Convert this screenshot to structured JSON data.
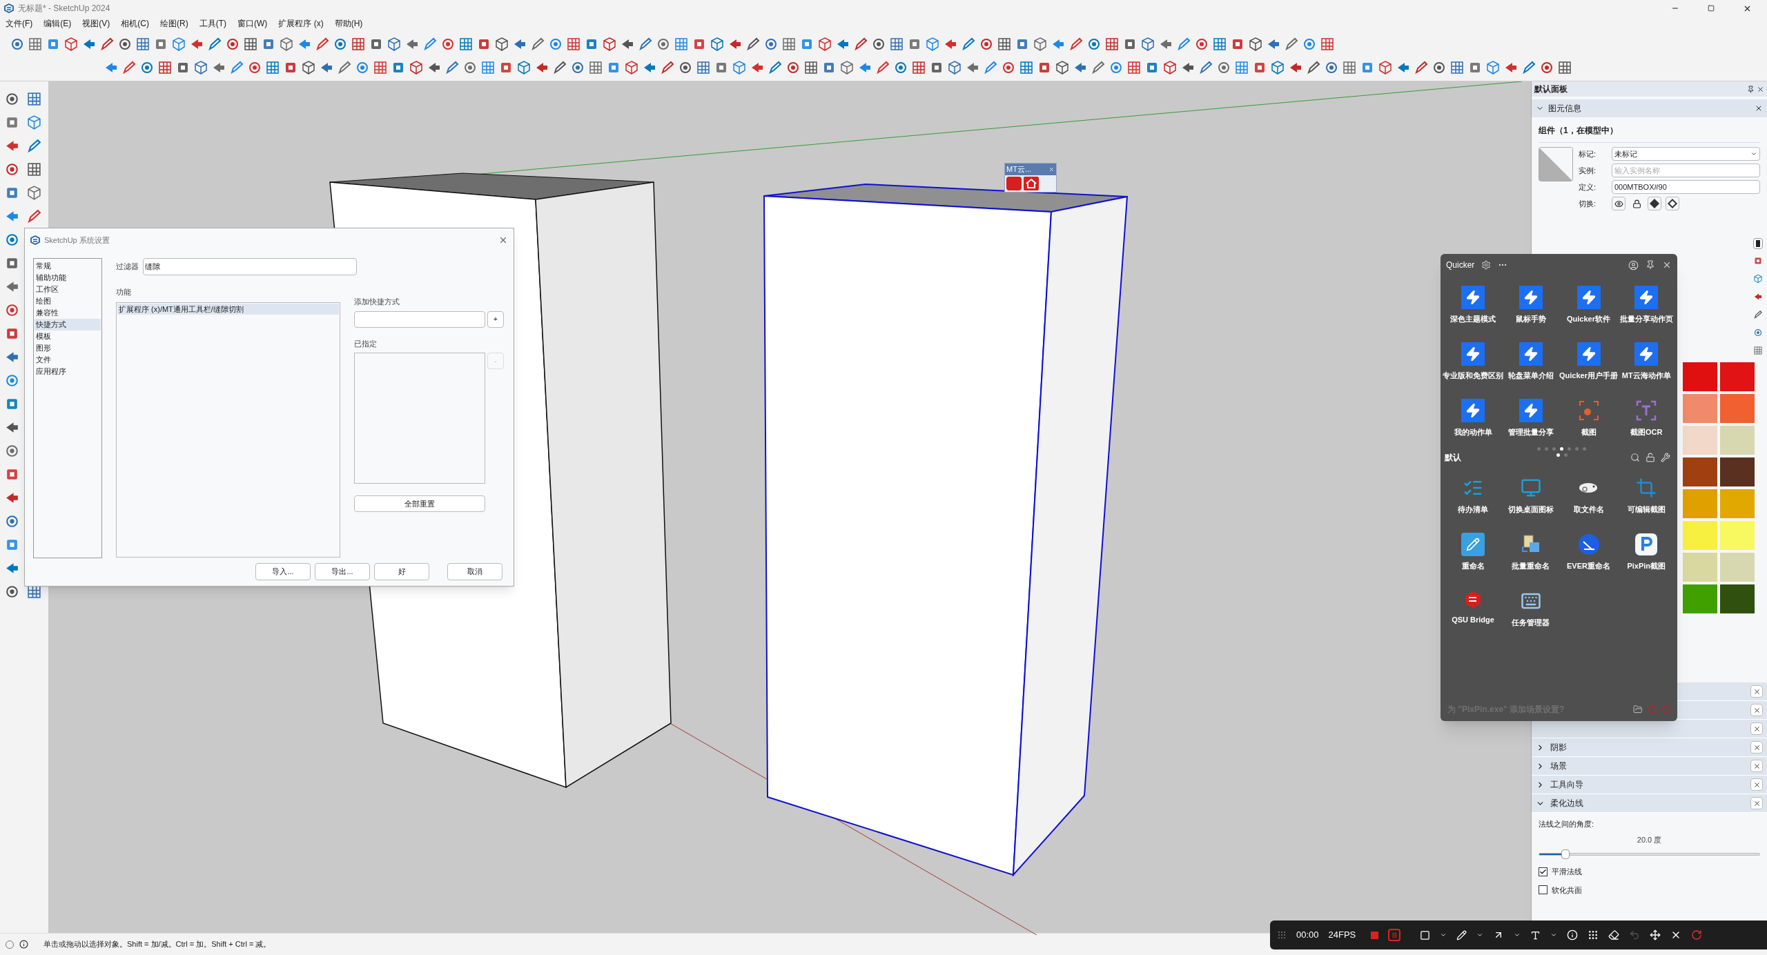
{
  "window": {
    "title": "无标题* - SketchUp 2024"
  },
  "menu": [
    "文件(F)",
    "编辑(E)",
    "视图(V)",
    "相机(C)",
    "绘图(R)",
    "工具(T)",
    "窗口(W)",
    "扩展程序 (x)",
    "帮助(H)"
  ],
  "viewport": {
    "tag": "MT云..."
  },
  "dialog": {
    "title": "SketchUp 系统设置",
    "categories": [
      {
        "label": "常规",
        "selected": false
      },
      {
        "label": "辅助功能",
        "selected": false
      },
      {
        "label": "工作区",
        "selected": false
      },
      {
        "label": "绘图",
        "selected": false
      },
      {
        "label": "兼容性",
        "selected": false
      },
      {
        "label": "快捷方式",
        "selected": true
      },
      {
        "label": "模板",
        "selected": false
      },
      {
        "label": "图形",
        "selected": false
      },
      {
        "label": "文件",
        "selected": false
      },
      {
        "label": "应用程序",
        "selected": false
      }
    ],
    "filter": {
      "label": "过滤器",
      "value": "缝隙"
    },
    "functions": {
      "label": "功能",
      "items": [
        {
          "label": "扩展程序 (x)/MT通用工具栏/缝隙切割",
          "selected": true
        }
      ]
    },
    "add_shortcut": {
      "label": "添加快捷方式",
      "button": "+"
    },
    "assigned": {
      "label": "已指定",
      "button": "-",
      "disabled": true
    },
    "reset": "全部重置",
    "buttons": [
      "导入...",
      "导出...",
      "好",
      "取消"
    ]
  },
  "tray": {
    "title": "默认面板",
    "entity_info": {
      "title": "图元信息",
      "expanded": true,
      "heading": "组件（1，在模型中）",
      "toggle_label": "切换:",
      "fields": [
        {
          "kind": "select",
          "label": "标记:",
          "value": "未标记"
        },
        {
          "kind": "input",
          "label": "实例:",
          "placeholder": "输入实例名称"
        },
        {
          "kind": "input",
          "label": "定义:",
          "value": "000MTBOX#90"
        }
      ]
    },
    "materials": [
      {
        "color": "#e01010"
      },
      {
        "color": "#e01414"
      },
      {
        "color": "#f08a6a"
      },
      {
        "color": "#f06030"
      },
      {
        "color": "#f2d8c8"
      },
      {
        "color": "#d8d8b0"
      },
      {
        "color": "#a04010"
      },
      {
        "color": "#5a3020"
      },
      {
        "color": "#e0a000"
      },
      {
        "color": "#e0a800"
      },
      {
        "color": "#f8f040"
      },
      {
        "color": "#f8f860"
      },
      {
        "color": "#d8d8a0"
      },
      {
        "color": "#d8d8b0"
      },
      {
        "color": "#40a000"
      },
      {
        "color": "#305010"
      }
    ],
    "sections": [
      {
        "title": "阴影",
        "expanded": false
      },
      {
        "title": "场景",
        "expanded": false
      },
      {
        "title": "工具向导",
        "expanded": false
      },
      {
        "title": "柔化边线",
        "expanded": true,
        "angle_label": "法线之间的角度:",
        "angle": "20.0 度",
        "level": 0.12,
        "options": [
          {
            "label": "平滑法线",
            "checked": true
          },
          {
            "label": "软化共面",
            "checked": false
          }
        ]
      }
    ]
  },
  "quicker": {
    "title": "Quicker",
    "actions": [
      {
        "kind": "action",
        "label": "深色主题模式"
      },
      {
        "kind": "action",
        "label": "鼠标手势"
      },
      {
        "kind": "action",
        "label": "Quicker软件"
      },
      {
        "kind": "action",
        "label": "批量分享动作页"
      },
      {
        "kind": "action",
        "label": "专业版和免费区别"
      },
      {
        "kind": "action",
        "label": "轮盘菜单介绍"
      },
      {
        "kind": "action",
        "label": "Quicker用户手册"
      },
      {
        "kind": "action",
        "label": "MT云海动作单"
      },
      {
        "kind": "action",
        "label": "我的动作单"
      },
      {
        "kind": "action",
        "label": "管理批量分享"
      },
      {
        "kind": "screenshot",
        "label": "截图"
      },
      {
        "kind": "ocr",
        "label": "截图OCR"
      }
    ],
    "pages": [
      {
        "selected": false
      },
      {
        "selected": false
      },
      {
        "selected": false
      },
      {
        "selected": true
      },
      {
        "selected": false
      },
      {
        "selected": false
      },
      {
        "selected": false
      }
    ],
    "subpages": [
      {
        "selected": true
      },
      {
        "selected": false
      }
    ],
    "group": "默认",
    "items": [
      {
        "kind": "todo",
        "label": "待办清单"
      },
      {
        "kind": "monitor",
        "label": "切换桌面图标"
      },
      {
        "kind": "chameleon",
        "label": "取文件名"
      },
      {
        "kind": "crop",
        "label": "可编辑截图"
      },
      {
        "kind": "pencil",
        "label": "重命名"
      },
      {
        "kind": "files",
        "label": "批量重命名"
      },
      {
        "kind": "ever",
        "label": "EVER重命名"
      },
      {
        "kind": "pixpin",
        "label": "PixPin截图"
      },
      {
        "kind": "sketchup",
        "label": "QSU Bridge"
      },
      {
        "kind": "keyboard",
        "label": "任务管理器"
      }
    ],
    "footer": "为 \"PixPin.exe\" 添加场景设置?"
  },
  "status_bar": {
    "text": "单击或拖动以选择对象。Shift = 加/减。Ctrl = 加。Shift + Ctrl = 减。"
  },
  "recorder": {
    "time": "00:00",
    "fps": "24FPS"
  }
}
